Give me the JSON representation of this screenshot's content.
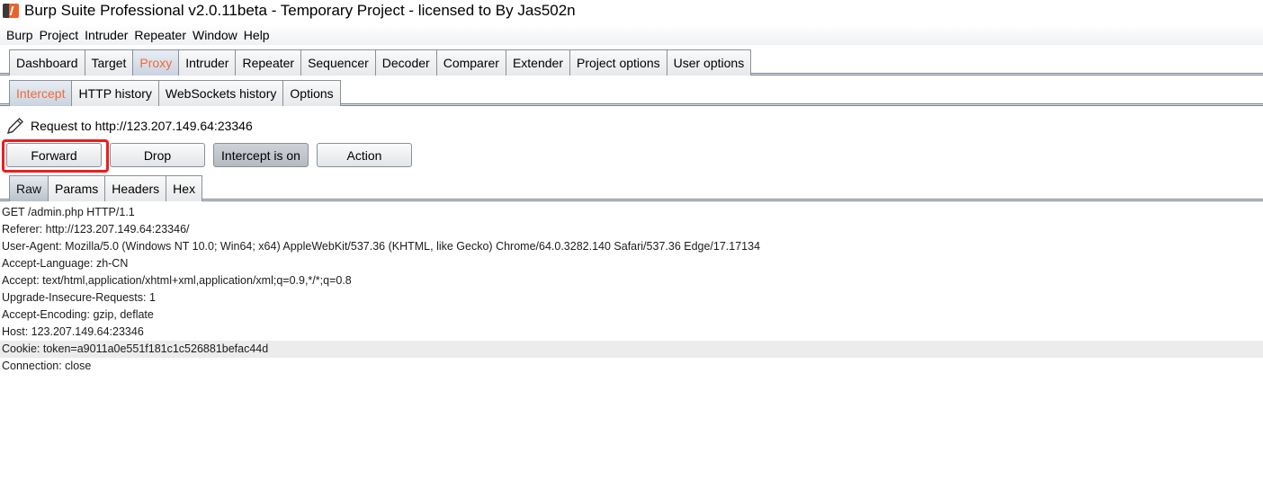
{
  "window": {
    "title": "Burp Suite Professional v2.0.11beta - Temporary Project - licensed to By Jas502n"
  },
  "menu": [
    "Burp",
    "Project",
    "Intruder",
    "Repeater",
    "Window",
    "Help"
  ],
  "main_tabs": [
    "Dashboard",
    "Target",
    "Proxy",
    "Intruder",
    "Repeater",
    "Sequencer",
    "Decoder",
    "Comparer",
    "Extender",
    "Project options",
    "User options"
  ],
  "proxy_tabs": [
    "Intercept",
    "HTTP history",
    "WebSockets history",
    "Options"
  ],
  "intercept": {
    "request_label": "Request to http://123.207.149.64:23346",
    "buttons": {
      "forward": "Forward",
      "drop": "Drop",
      "intercept_toggle": "Intercept is on",
      "action": "Action"
    }
  },
  "message_tabs": [
    "Raw",
    "Params",
    "Headers",
    "Hex"
  ],
  "raw_request": [
    "GET /admin.php HTTP/1.1",
    "Referer: http://123.207.149.64:23346/",
    "User-Agent: Mozilla/5.0 (Windows NT 10.0; Win64; x64) AppleWebKit/537.36 (KHTML, like Gecko) Chrome/64.0.3282.140 Safari/537.36 Edge/17.17134",
    "Accept-Language: zh-CN",
    "Accept: text/html,application/xhtml+xml,application/xml;q=0.9,*/*;q=0.8",
    "Upgrade-Insecure-Requests: 1",
    "Accept-Encoding: gzip, deflate",
    "Host: 123.207.149.64:23346",
    "Cookie: token=a9011a0e551f181c1c526881befac44d",
    "Connection: close"
  ],
  "colors": {
    "active_tab_text": "#ee6a3c",
    "highlight_box": "#ee1d1d"
  }
}
